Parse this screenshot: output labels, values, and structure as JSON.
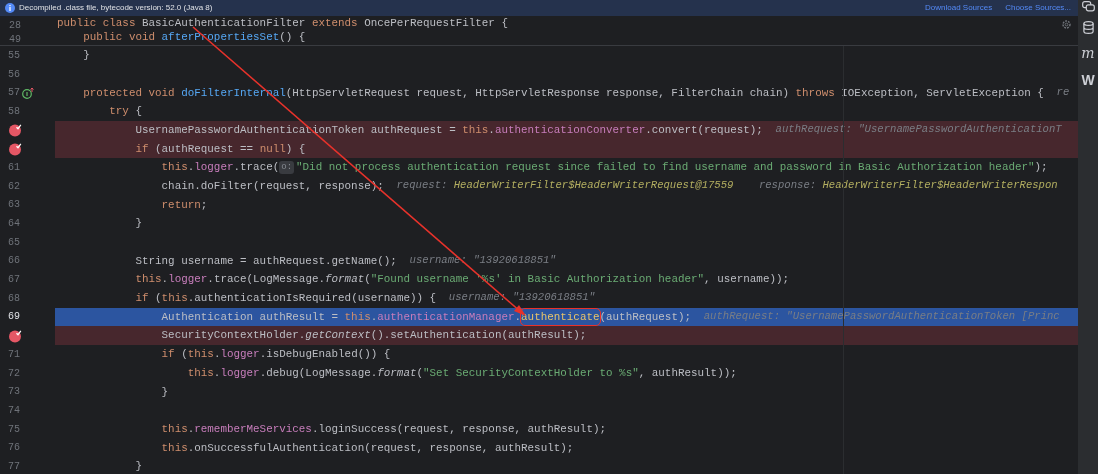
{
  "banner": {
    "text": "Decompiled .class file, bytecode version: 52.0 (Java 8)",
    "links": [
      "Download Sources",
      "Choose Sources..."
    ]
  },
  "sticky_lines": [
    {
      "number": "28",
      "tokens": [
        {
          "t": "public class ",
          "kind": "kw"
        },
        {
          "t": "BasicAuthenticationFilter ",
          "kind": "id"
        },
        {
          "t": "extends ",
          "kind": "kw"
        },
        {
          "t": "OncePerRequestFilter {",
          "kind": "id"
        }
      ]
    },
    {
      "number": "49",
      "tokens": [
        {
          "t": "    public void ",
          "kind": "kw"
        },
        {
          "t": "afterPropertiesSet",
          "kind": "decl"
        },
        {
          "t": "() {",
          "kind": "id"
        }
      ]
    }
  ],
  "lines": [
    {
      "number": "55",
      "breakpoint": false,
      "current": false,
      "tokens": [
        {
          "t": "    }",
          "kind": "id"
        }
      ]
    },
    {
      "number": "56",
      "breakpoint": false,
      "current": false
    },
    {
      "number": "57",
      "breakpoint": false,
      "current": false,
      "overrides": true,
      "tokens": [
        {
          "t": "    protected void ",
          "kind": "kw"
        },
        {
          "t": "doFilterInternal",
          "kind": "decl"
        },
        {
          "t": "(HttpServletRequest request, HttpServletResponse response, FilterChain chain) ",
          "kind": "id"
        },
        {
          "t": "throws ",
          "kind": "kw"
        },
        {
          "t": "IOException, ServletException {",
          "kind": "id"
        },
        {
          "t": "  re",
          "kind": "hint"
        }
      ]
    },
    {
      "number": "58",
      "breakpoint": false,
      "current": false,
      "tokens": [
        {
          "t": "        try ",
          "kind": "kw"
        },
        {
          "t": "{",
          "kind": "id"
        }
      ]
    },
    {
      "breakpoint": true,
      "current": false,
      "tokens": [
        {
          "t": "            UsernamePasswordAuthenticationToken authRequest = ",
          "kind": "id"
        },
        {
          "t": "this",
          "kind": "kw"
        },
        {
          "t": ".",
          "kind": "id"
        },
        {
          "t": "authenticationConverter",
          "kind": "field"
        },
        {
          "t": ".convert(request);",
          "kind": "id"
        },
        {
          "t": "  authRequest: \"UsernamePasswordAuthenticationT",
          "kind": "hint"
        }
      ]
    },
    {
      "breakpoint": true,
      "current": false,
      "tokens": [
        {
          "t": "            if ",
          "kind": "kw"
        },
        {
          "t": "(authRequest == ",
          "kind": "id"
        },
        {
          "t": "null",
          "kind": "kw"
        },
        {
          "t": ") {",
          "kind": "id"
        }
      ]
    },
    {
      "number": "61",
      "breakpoint": false,
      "current": false,
      "tokens": [
        {
          "t": "                this",
          "kind": "kw"
        },
        {
          "t": ".",
          "kind": "id"
        },
        {
          "t": "logger",
          "kind": "field"
        },
        {
          "t": ".trace(",
          "kind": "id"
        },
        {
          "t": "o:",
          "kind": "chip"
        },
        {
          "t": "\"Did not process authentication request since failed to find username and password in Basic Authorization header\"",
          "kind": "str"
        },
        {
          "t": ");",
          "kind": "id"
        }
      ]
    },
    {
      "number": "62",
      "breakpoint": false,
      "current": false,
      "tokens": [
        {
          "t": "                chain.doFilter(request, response);",
          "kind": "id"
        },
        {
          "t": "  request: ",
          "kind": "hint"
        },
        {
          "t": "HeaderWriterFilter$HeaderWriterRequest@17559",
          "kind": "hintval"
        },
        {
          "t": "    response: ",
          "kind": "hint"
        },
        {
          "t": "HeaderWriterFilter$HeaderWriterRespon",
          "kind": "hintval"
        }
      ]
    },
    {
      "number": "63",
      "breakpoint": false,
      "current": false,
      "tokens": [
        {
          "t": "                return",
          "kind": "kw"
        },
        {
          "t": ";",
          "kind": "id"
        }
      ]
    },
    {
      "number": "64",
      "breakpoint": false,
      "current": false,
      "tokens": [
        {
          "t": "            }",
          "kind": "id"
        }
      ]
    },
    {
      "number": "65",
      "breakpoint": false,
      "current": false
    },
    {
      "number": "66",
      "breakpoint": false,
      "current": false,
      "tokens": [
        {
          "t": "            String username = authRequest.getName();",
          "kind": "id"
        },
        {
          "t": "  username: \"13920618851\"",
          "kind": "hint"
        }
      ]
    },
    {
      "number": "67",
      "breakpoint": false,
      "current": false,
      "tokens": [
        {
          "t": "            this",
          "kind": "kw"
        },
        {
          "t": ".",
          "kind": "id"
        },
        {
          "t": "logger",
          "kind": "field"
        },
        {
          "t": ".trace(LogMessage.",
          "kind": "id"
        },
        {
          "t": "format",
          "kind": "static"
        },
        {
          "t": "(",
          "kind": "id"
        },
        {
          "t": "\"Found username '%s' in Basic Authorization header\"",
          "kind": "str"
        },
        {
          "t": ", username));",
          "kind": "id"
        }
      ]
    },
    {
      "number": "68",
      "breakpoint": false,
      "current": false,
      "tokens": [
        {
          "t": "            if ",
          "kind": "kw"
        },
        {
          "t": "(",
          "kind": "id"
        },
        {
          "t": "this",
          "kind": "kw"
        },
        {
          "t": ".authenticationIsRequired(username)) {",
          "kind": "id"
        },
        {
          "t": "  username: \"13920618851\"",
          "kind": "hint"
        }
      ]
    },
    {
      "number": "69",
      "breakpoint": false,
      "current": true,
      "tokens": [
        {
          "t": "                Authentication authResult = ",
          "kind": "id"
        },
        {
          "t": "this",
          "kind": "kw"
        },
        {
          "t": ".",
          "kind": "id"
        },
        {
          "t": "authenticationManager",
          "kind": "field"
        },
        {
          "t": ".",
          "kind": "id"
        },
        {
          "t": "authenticate",
          "kind": "call",
          "boxed": true
        },
        {
          "t": "(authRequest);",
          "kind": "id"
        },
        {
          "t": "  authRequest: \"UsernamePasswordAuthenticationToken [Princ",
          "kind": "hint"
        }
      ]
    },
    {
      "breakpoint": true,
      "current": false,
      "tokens": [
        {
          "t": "                SecurityContextHolder.",
          "kind": "id"
        },
        {
          "t": "getContext",
          "kind": "static"
        },
        {
          "t": "().setAuthentication(authResult);",
          "kind": "id"
        }
      ]
    },
    {
      "number": "71",
      "breakpoint": false,
      "current": false,
      "tokens": [
        {
          "t": "                if ",
          "kind": "kw"
        },
        {
          "t": "(",
          "kind": "id"
        },
        {
          "t": "this",
          "kind": "kw"
        },
        {
          "t": ".",
          "kind": "id"
        },
        {
          "t": "logger",
          "kind": "field"
        },
        {
          "t": ".isDebugEnabled()) {",
          "kind": "id"
        }
      ]
    },
    {
      "number": "72",
      "breakpoint": false,
      "current": false,
      "tokens": [
        {
          "t": "                    this",
          "kind": "kw"
        },
        {
          "t": ".",
          "kind": "id"
        },
        {
          "t": "logger",
          "kind": "field"
        },
        {
          "t": ".debug(LogMessage.",
          "kind": "id"
        },
        {
          "t": "format",
          "kind": "static"
        },
        {
          "t": "(",
          "kind": "id"
        },
        {
          "t": "\"Set SecurityContextHolder to %s\"",
          "kind": "str"
        },
        {
          "t": ", authResult));",
          "kind": "id"
        }
      ]
    },
    {
      "number": "73",
      "breakpoint": false,
      "current": false,
      "tokens": [
        {
          "t": "                }",
          "kind": "id"
        }
      ]
    },
    {
      "number": "74",
      "breakpoint": false,
      "current": false
    },
    {
      "number": "75",
      "breakpoint": false,
      "current": false,
      "tokens": [
        {
          "t": "                this",
          "kind": "kw"
        },
        {
          "t": ".",
          "kind": "id"
        },
        {
          "t": "rememberMeServices",
          "kind": "field"
        },
        {
          "t": ".loginSuccess(request, response, authResult);",
          "kind": "id"
        }
      ]
    },
    {
      "number": "76",
      "breakpoint": false,
      "current": false,
      "tokens": [
        {
          "t": "                this",
          "kind": "kw"
        },
        {
          "t": ".onSuccessfulAuthentication(request, response, authResult);",
          "kind": "id"
        }
      ]
    },
    {
      "number": "77",
      "breakpoint": false,
      "current": false,
      "tokens": [
        {
          "t": "            }",
          "kind": "id"
        }
      ]
    }
  ],
  "tool_strip": [
    "m",
    "W"
  ]
}
